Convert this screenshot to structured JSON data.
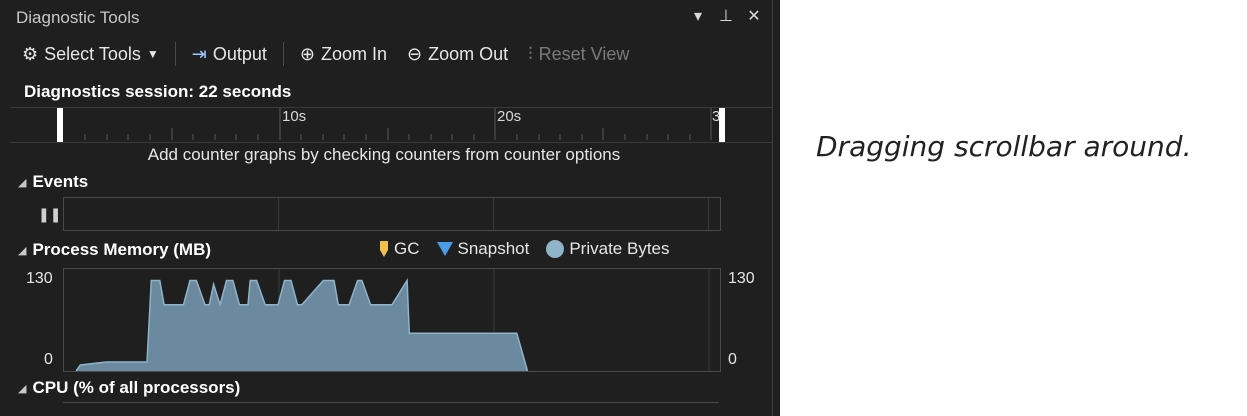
{
  "window": {
    "title": "Diagnostic Tools",
    "icons": [
      "dropdown-arrow-icon",
      "pin-icon",
      "close-icon"
    ]
  },
  "toolbar": {
    "select_tools": "Select Tools",
    "output": "Output",
    "zoom_in": "Zoom In",
    "zoom_out": "Zoom Out",
    "reset_view": "Reset View"
  },
  "session": {
    "label": "Diagnostics session: 22 seconds"
  },
  "ruler": {
    "ticks": [
      "10s",
      "20s",
      "3"
    ]
  },
  "hint": "Add counter graphs by checking counters from counter options",
  "events": {
    "title": "Events"
  },
  "memory": {
    "title": "Process Memory (MB)",
    "legend": {
      "gc": "GC",
      "snapshot": "Snapshot",
      "private_bytes": "Private Bytes"
    },
    "y_max": "130",
    "y_min": "0",
    "colors": {
      "gc": "#f5c04a",
      "snapshot": "#4a9de8",
      "private_bytes": "#8fb3c9",
      "area": "#6b8aa0"
    }
  },
  "cpu": {
    "title": "CPU (% of all processors)"
  },
  "caption": "Dragging scrollbar around.",
  "chart_data": {
    "type": "area",
    "x": [
      0,
      0.2,
      1.4,
      3.3,
      3.5,
      3.9,
      4.1,
      5.0,
      5.3,
      5.6,
      6.0,
      6.2,
      6.4,
      6.7,
      7.0,
      7.3,
      7.6,
      8.0,
      8.1,
      8.4,
      8.8,
      9.4,
      9.7,
      10.0,
      10.3,
      10.5,
      11.5,
      12.0,
      12.2,
      12.7,
      13.1,
      13.3,
      13.7,
      14.7,
      15.4,
      15.5,
      20.5,
      21.0
    ],
    "y": [
      0,
      8,
      12,
      12,
      120,
      120,
      88,
      88,
      120,
      120,
      88,
      88,
      115,
      88,
      120,
      120,
      88,
      88,
      120,
      120,
      88,
      88,
      120,
      120,
      88,
      88,
      120,
      120,
      88,
      88,
      120,
      120,
      88,
      88,
      120,
      50,
      50,
      0
    ],
    "ylim": [
      0,
      130
    ],
    "series": [
      {
        "name": "Private Bytes"
      }
    ]
  }
}
